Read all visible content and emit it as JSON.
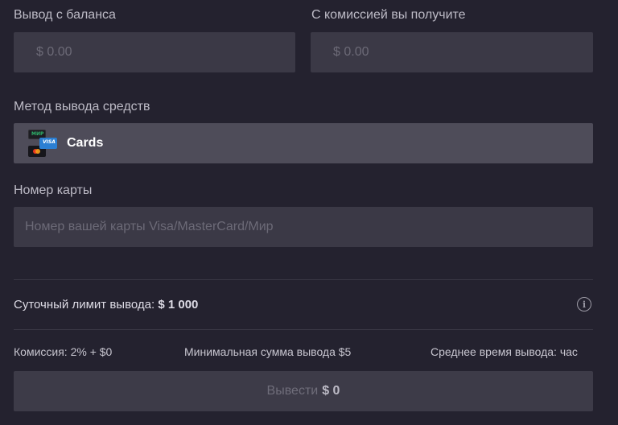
{
  "withdraw": {
    "label": "Вывод с баланса",
    "placeholder": "$ 0.00"
  },
  "receive": {
    "label": "С комиссией вы получите",
    "placeholder": "$ 0.00"
  },
  "method": {
    "label": "Метод вывода средств",
    "selected": "Cards",
    "icon": "cards-mir-visa-mastercard-icon",
    "icon_text": {
      "mir": "МИР",
      "visa": "VISA"
    }
  },
  "card_number": {
    "label": "Номер карты",
    "placeholder": "Номер вашей карты Visa/MasterCard/Мир"
  },
  "limit": {
    "text": "Суточный лимит вывода:",
    "value": "$ 1 000",
    "info_icon": "i"
  },
  "stats": {
    "commission": "Комиссия: 2% + $0",
    "min_amount": "Минимальная сумма вывода $5",
    "avg_time": "Среднее время вывода:  час"
  },
  "submit": {
    "label": "Вывести",
    "amount": "$ 0",
    "enabled": false
  },
  "colors": {
    "background": "#24222f",
    "field": "#3b3946",
    "method_selected": "#4e4c59",
    "button_disabled": "#3d3b48"
  }
}
